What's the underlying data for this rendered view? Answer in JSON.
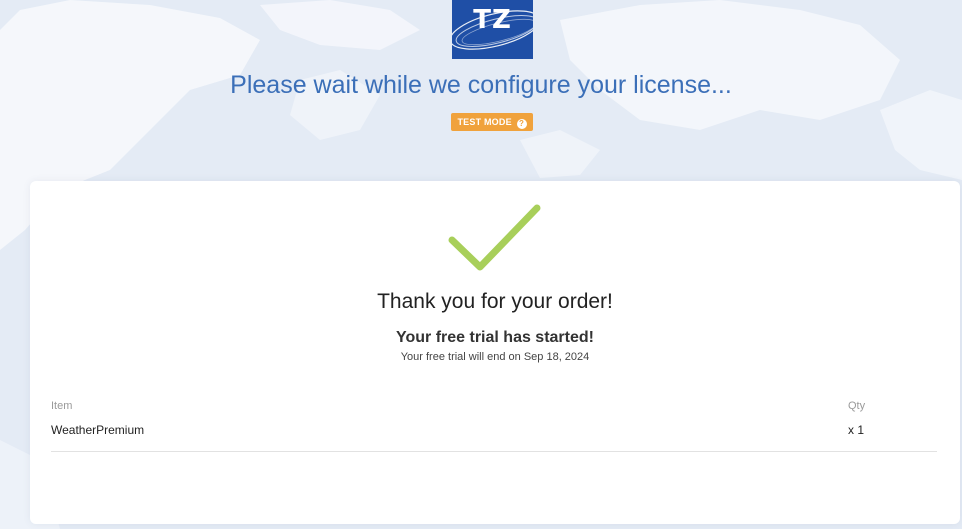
{
  "logo": {
    "text": "TZ"
  },
  "header": {
    "title": "Please wait while we configure your license...",
    "badge_label": "TEST MODE",
    "badge_icon": "question-circle-icon"
  },
  "confirmation": {
    "check_icon": "check-icon",
    "check_color": "#a8cf5a",
    "title": "Thank you for your order!",
    "subtitle": "Your free trial has started!",
    "detail": "Your free trial will end on Sep 18, 2024"
  },
  "order_table": {
    "columns": [
      "Item",
      "Qty"
    ],
    "rows": [
      {
        "item": "WeatherPremium",
        "qty": "x 1"
      }
    ]
  },
  "colors": {
    "brand_blue": "#1f4fa6",
    "headline_blue": "#3b6fb8",
    "badge_orange": "#f0a23c"
  }
}
